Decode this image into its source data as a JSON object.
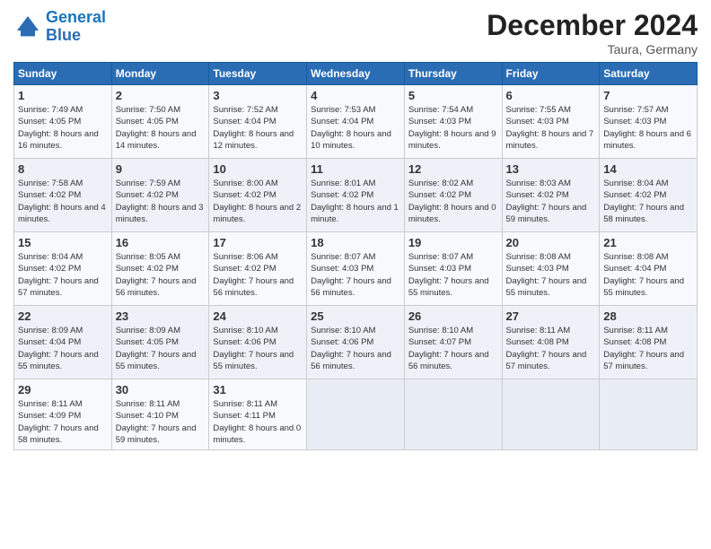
{
  "header": {
    "logo_line1": "General",
    "logo_line2": "Blue",
    "month": "December 2024",
    "location": "Taura, Germany"
  },
  "days_of_week": [
    "Sunday",
    "Monday",
    "Tuesday",
    "Wednesday",
    "Thursday",
    "Friday",
    "Saturday"
  ],
  "weeks": [
    [
      {
        "day": "1",
        "sunrise": "7:49 AM",
        "sunset": "4:05 PM",
        "daylight": "8 hours and 16 minutes."
      },
      {
        "day": "2",
        "sunrise": "7:50 AM",
        "sunset": "4:05 PM",
        "daylight": "8 hours and 14 minutes."
      },
      {
        "day": "3",
        "sunrise": "7:52 AM",
        "sunset": "4:04 PM",
        "daylight": "8 hours and 12 minutes."
      },
      {
        "day": "4",
        "sunrise": "7:53 AM",
        "sunset": "4:04 PM",
        "daylight": "8 hours and 10 minutes."
      },
      {
        "day": "5",
        "sunrise": "7:54 AM",
        "sunset": "4:03 PM",
        "daylight": "8 hours and 9 minutes."
      },
      {
        "day": "6",
        "sunrise": "7:55 AM",
        "sunset": "4:03 PM",
        "daylight": "8 hours and 7 minutes."
      },
      {
        "day": "7",
        "sunrise": "7:57 AM",
        "sunset": "4:03 PM",
        "daylight": "8 hours and 6 minutes."
      }
    ],
    [
      {
        "day": "8",
        "sunrise": "7:58 AM",
        "sunset": "4:02 PM",
        "daylight": "8 hours and 4 minutes."
      },
      {
        "day": "9",
        "sunrise": "7:59 AM",
        "sunset": "4:02 PM",
        "daylight": "8 hours and 3 minutes."
      },
      {
        "day": "10",
        "sunrise": "8:00 AM",
        "sunset": "4:02 PM",
        "daylight": "8 hours and 2 minutes."
      },
      {
        "day": "11",
        "sunrise": "8:01 AM",
        "sunset": "4:02 PM",
        "daylight": "8 hours and 1 minute."
      },
      {
        "day": "12",
        "sunrise": "8:02 AM",
        "sunset": "4:02 PM",
        "daylight": "8 hours and 0 minutes."
      },
      {
        "day": "13",
        "sunrise": "8:03 AM",
        "sunset": "4:02 PM",
        "daylight": "7 hours and 59 minutes."
      },
      {
        "day": "14",
        "sunrise": "8:04 AM",
        "sunset": "4:02 PM",
        "daylight": "7 hours and 58 minutes."
      }
    ],
    [
      {
        "day": "15",
        "sunrise": "8:04 AM",
        "sunset": "4:02 PM",
        "daylight": "7 hours and 57 minutes."
      },
      {
        "day": "16",
        "sunrise": "8:05 AM",
        "sunset": "4:02 PM",
        "daylight": "7 hours and 56 minutes."
      },
      {
        "day": "17",
        "sunrise": "8:06 AM",
        "sunset": "4:02 PM",
        "daylight": "7 hours and 56 minutes."
      },
      {
        "day": "18",
        "sunrise": "8:07 AM",
        "sunset": "4:03 PM",
        "daylight": "7 hours and 56 minutes."
      },
      {
        "day": "19",
        "sunrise": "8:07 AM",
        "sunset": "4:03 PM",
        "daylight": "7 hours and 55 minutes."
      },
      {
        "day": "20",
        "sunrise": "8:08 AM",
        "sunset": "4:03 PM",
        "daylight": "7 hours and 55 minutes."
      },
      {
        "day": "21",
        "sunrise": "8:08 AM",
        "sunset": "4:04 PM",
        "daylight": "7 hours and 55 minutes."
      }
    ],
    [
      {
        "day": "22",
        "sunrise": "8:09 AM",
        "sunset": "4:04 PM",
        "daylight": "7 hours and 55 minutes."
      },
      {
        "day": "23",
        "sunrise": "8:09 AM",
        "sunset": "4:05 PM",
        "daylight": "7 hours and 55 minutes."
      },
      {
        "day": "24",
        "sunrise": "8:10 AM",
        "sunset": "4:06 PM",
        "daylight": "7 hours and 55 minutes."
      },
      {
        "day": "25",
        "sunrise": "8:10 AM",
        "sunset": "4:06 PM",
        "daylight": "7 hours and 56 minutes."
      },
      {
        "day": "26",
        "sunrise": "8:10 AM",
        "sunset": "4:07 PM",
        "daylight": "7 hours and 56 minutes."
      },
      {
        "day": "27",
        "sunrise": "8:11 AM",
        "sunset": "4:08 PM",
        "daylight": "7 hours and 57 minutes."
      },
      {
        "day": "28",
        "sunrise": "8:11 AM",
        "sunset": "4:08 PM",
        "daylight": "7 hours and 57 minutes."
      }
    ],
    [
      {
        "day": "29",
        "sunrise": "8:11 AM",
        "sunset": "4:09 PM",
        "daylight": "7 hours and 58 minutes."
      },
      {
        "day": "30",
        "sunrise": "8:11 AM",
        "sunset": "4:10 PM",
        "daylight": "7 hours and 59 minutes."
      },
      {
        "day": "31",
        "sunrise": "8:11 AM",
        "sunset": "4:11 PM",
        "daylight": "8 hours and 0 minutes."
      },
      null,
      null,
      null,
      null
    ]
  ]
}
